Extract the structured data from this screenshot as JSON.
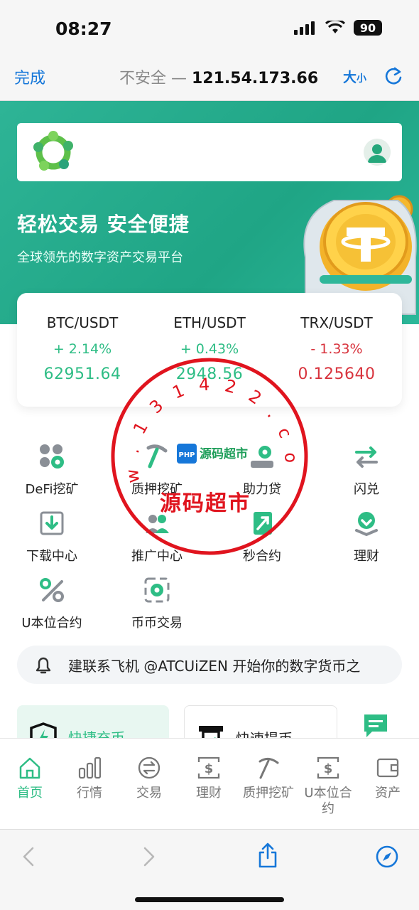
{
  "status_bar": {
    "time": "08:27",
    "battery": "90"
  },
  "browser": {
    "done": "完成",
    "insecure_label": "不安全 —",
    "host": "121.54.173.66",
    "text_size_big": "大",
    "text_size_small": "小"
  },
  "hero": {
    "title": "轻松交易 安全便捷",
    "subtitle": "全球领先的数字资产交易平台"
  },
  "tickers": [
    {
      "pair": "BTC/USDT",
      "change": "+ 2.14%",
      "price": "62951.64",
      "direction": "up"
    },
    {
      "pair": "ETH/USDT",
      "change": "+ 0.43%",
      "price": "2948.56",
      "direction": "up"
    },
    {
      "pair": "TRX/USDT",
      "change": "- 1.33%",
      "price": "0.125640",
      "direction": "down"
    }
  ],
  "features": [
    {
      "label": "DeFi挖矿",
      "icon": "defi-mining-icon"
    },
    {
      "label": "质押挖矿",
      "icon": "pickaxe-icon"
    },
    {
      "label": "助力贷",
      "icon": "loan-icon"
    },
    {
      "label": "闪兑",
      "icon": "swap-arrows-icon"
    },
    {
      "label": "下载中心",
      "icon": "download-icon"
    },
    {
      "label": "推广中心",
      "icon": "users-icon"
    },
    {
      "label": "秒合约",
      "icon": "contract-icon"
    },
    {
      "label": "理财",
      "icon": "finance-icon"
    },
    {
      "label": "U本位合约",
      "icon": "percent-icon"
    },
    {
      "label": "币币交易",
      "icon": "coin-exchange-icon"
    }
  ],
  "notice": {
    "text": "建联系飞机 @ATCUiZEN 开始你的数字货币之"
  },
  "quick_actions": [
    {
      "label": "快捷充币"
    },
    {
      "label": "快速提币"
    }
  ],
  "tabs": [
    {
      "label": "首页",
      "icon": "home-icon",
      "active": true
    },
    {
      "label": "行情",
      "icon": "bar-chart-icon",
      "active": false
    },
    {
      "label": "交易",
      "icon": "exchange-icon",
      "active": false
    },
    {
      "label": "理财",
      "icon": "finance-dollar-icon",
      "active": false
    },
    {
      "label": "质押挖矿",
      "icon": "pickaxe-icon",
      "active": false
    },
    {
      "label": "U本位合约",
      "icon": "contract-dollar-icon",
      "active": false
    },
    {
      "label": "资产",
      "icon": "wallet-icon",
      "active": false
    }
  ],
  "watermark": {
    "ring_text": "w . 1 3 1 4 2 2 . c o m",
    "center_text": "源码超市",
    "bottom_text": "源码超市"
  },
  "colors": {
    "accent": "#2ebd85",
    "up": "#2ebd85",
    "down": "#d8333d",
    "link": "#1677d9",
    "stamp": "#e0141e"
  }
}
